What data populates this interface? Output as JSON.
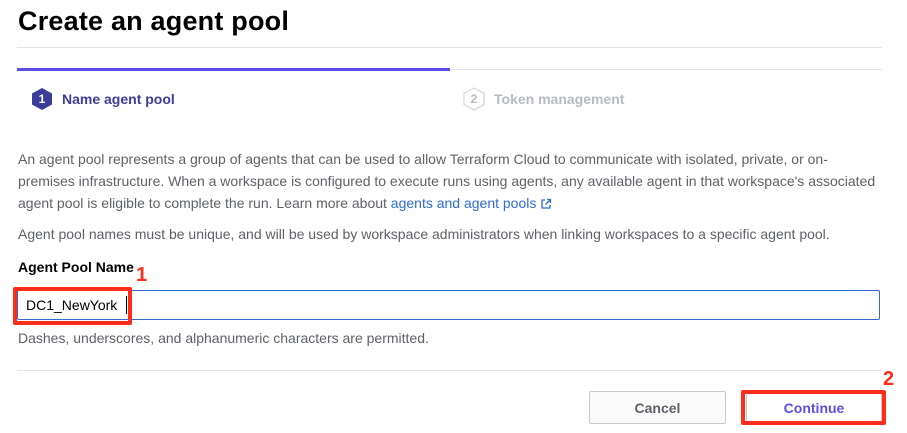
{
  "page": {
    "title": "Create an agent pool"
  },
  "stepper": {
    "steps": [
      {
        "number": "1",
        "label": "Name agent pool",
        "state": "active"
      },
      {
        "number": "2",
        "label": "Token management",
        "state": "inactive"
      }
    ]
  },
  "intro": {
    "text_before_link": "An agent pool represents a group of agents that can be used to allow Terraform Cloud to communicate with isolated, private, or on-premises infrastructure. When a workspace is configured to execute runs using agents, any available agent in that workspace's associated agent pool is eligible to complete the run. Learn more about ",
    "link_text": "agents and agent pools",
    "link_icon": "external-link-icon"
  },
  "uniqueness_note": "Agent pool names must be unique, and will be used by workspace administrators when linking workspaces to a specific agent pool.",
  "form": {
    "field_label": "Agent Pool Name",
    "field_value": "DC1_NewYork",
    "hint": "Dashes, underscores, and alphanumeric characters are permitted."
  },
  "actions": {
    "cancel_label": "Cancel",
    "continue_label": "Continue"
  },
  "annotations": {
    "marker_1": "1",
    "marker_2": "2",
    "color": "#ff2d1a"
  },
  "colors": {
    "accent": "#5c4ee5",
    "link": "#2f6bd1",
    "step_active_text": "#3b3d98",
    "step_inactive_text": "#b8bac1"
  }
}
